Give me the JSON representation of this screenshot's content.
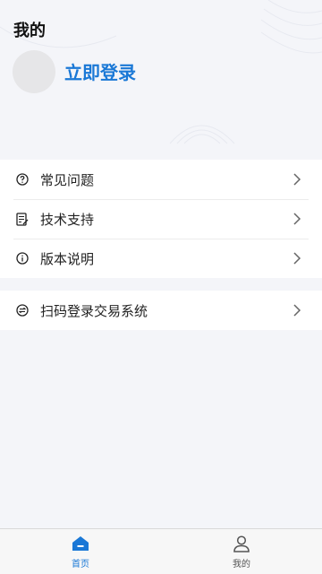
{
  "header": {
    "title": "我的",
    "login_label": "立即登录"
  },
  "menu": {
    "group1": [
      {
        "label": "常见问题",
        "icon": "question-circle-icon"
      },
      {
        "label": "技术支持",
        "icon": "document-edit-icon"
      },
      {
        "label": "版本说明",
        "icon": "info-circle-icon"
      }
    ],
    "group2": [
      {
        "label": "扫码登录交易系统",
        "icon": "exchange-circle-icon"
      }
    ]
  },
  "tabbar": {
    "tabs": [
      {
        "label": "首页",
        "icon": "home-icon",
        "active": true
      },
      {
        "label": "我的",
        "icon": "user-icon",
        "active": false
      }
    ]
  },
  "colors": {
    "accent": "#1a78d6",
    "background": "#f4f5f9",
    "avatar": "#e6e6e8"
  }
}
